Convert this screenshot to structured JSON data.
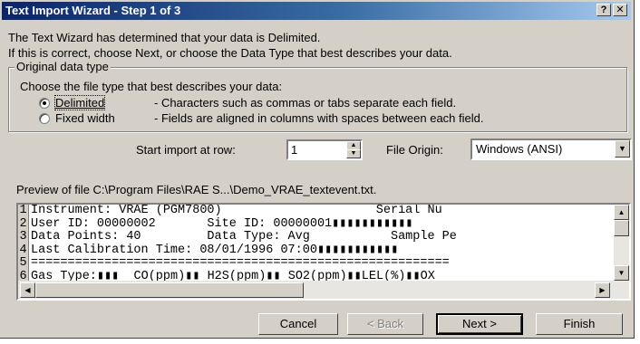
{
  "window": {
    "title": "Text Import Wizard - Step 1 of 3",
    "help_button": "?",
    "close_button": "✕"
  },
  "intro": {
    "line1": "The Text Wizard has determined that your data is Delimited.",
    "line2": "If this is correct, choose Next, or choose the Data Type that best describes your data."
  },
  "data_type": {
    "group_label": "Original data type",
    "prompt": "Choose the file type that best describes your data:",
    "options": [
      {
        "label": "Delimited",
        "description": "- Characters such as commas or tabs separate each field.",
        "selected": true
      },
      {
        "label": "Fixed width",
        "description": "- Fields are aligned in columns with spaces between each field.",
        "selected": false
      }
    ]
  },
  "start_import": {
    "label": "Start import at row:",
    "value": "1"
  },
  "file_origin": {
    "label": "File Origin:",
    "value": "Windows (ANSI)"
  },
  "preview": {
    "label": "Preview of file C:\\Program Files\\RAE S...\\Demo_VRAE_textevent.txt.",
    "rows": [
      {
        "num": "1",
        "text": "Instrument: VRAE (PGM7800)                     Serial Nu"
      },
      {
        "num": "2",
        "text": "User ID: 00000002       Site ID: 00000001▮▮▮▮▮▮▮▮▮▮▮"
      },
      {
        "num": "3",
        "text": "Data Points: 40         Data Type: Avg           Sample Pe"
      },
      {
        "num": "4",
        "text": "Last Calibration Time: 08/01/1996 07:00▮▮▮▮▮▮▮▮▮▮▮"
      },
      {
        "num": "5",
        "text": "========================================================="
      },
      {
        "num": "6",
        "text": "Gas Type:▮▮▮  CO(ppm)▮▮ H2S(ppm)▮▮ SO2(ppm)▮▮LEL(%)▮▮OX"
      }
    ]
  },
  "buttons": {
    "cancel": "Cancel",
    "back": "< Back",
    "next": "Next >",
    "finish": "Finish"
  },
  "colors": {
    "title_bar_start": "#0a246a",
    "title_bar_end": "#a6caf0",
    "dialog_face": "#d4d0c8"
  }
}
